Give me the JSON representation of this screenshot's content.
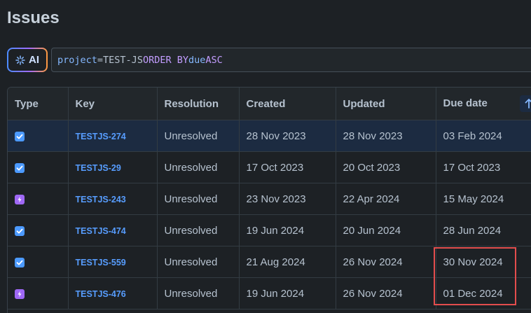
{
  "page": {
    "title": "Issues"
  },
  "search": {
    "ai_label": "AI",
    "query": {
      "field": "project",
      "operator": "=",
      "value": "TEST-JS",
      "order_by": "ORDER BY",
      "order_field": "due",
      "order_dir": "ASC"
    }
  },
  "table": {
    "headers": {
      "type": "Type",
      "key": "Key",
      "resolution": "Resolution",
      "created": "Created",
      "updated": "Updated",
      "due": "Due date"
    },
    "sort_icon": "arrow-up-icon",
    "rows": [
      {
        "type": "task",
        "key": "TESTJS-274",
        "resolution": "Unresolved",
        "created": "28 Nov 2023",
        "updated": "28 Nov 2023",
        "due": "03 Feb 2024"
      },
      {
        "type": "task",
        "key": "TESTJS-29",
        "resolution": "Unresolved",
        "created": "17 Oct 2023",
        "updated": "20 Oct 2023",
        "due": "17 Oct 2023"
      },
      {
        "type": "epic",
        "key": "TESTJS-243",
        "resolution": "Unresolved",
        "created": "23 Nov 2023",
        "updated": "22 Apr 2024",
        "due": "15 May 2024"
      },
      {
        "type": "task",
        "key": "TESTJS-474",
        "resolution": "Unresolved",
        "created": "19 Jun 2024",
        "updated": "20 Jun 2024",
        "due": "28 Jun 2024"
      },
      {
        "type": "task",
        "key": "TESTJS-559",
        "resolution": "Unresolved",
        "created": "21 Aug 2024",
        "updated": "26 Nov 2024",
        "due": "30 Nov 2024"
      },
      {
        "type": "epic",
        "key": "TESTJS-476",
        "resolution": "Unresolved",
        "created": "19 Jun 2024",
        "updated": "26 Nov 2024",
        "due": "01 Dec 2024"
      }
    ]
  },
  "colors": {
    "task": "#4c9aff",
    "epic": "#9f68f5",
    "highlight": "#e34d4d",
    "link": "#579dff"
  }
}
